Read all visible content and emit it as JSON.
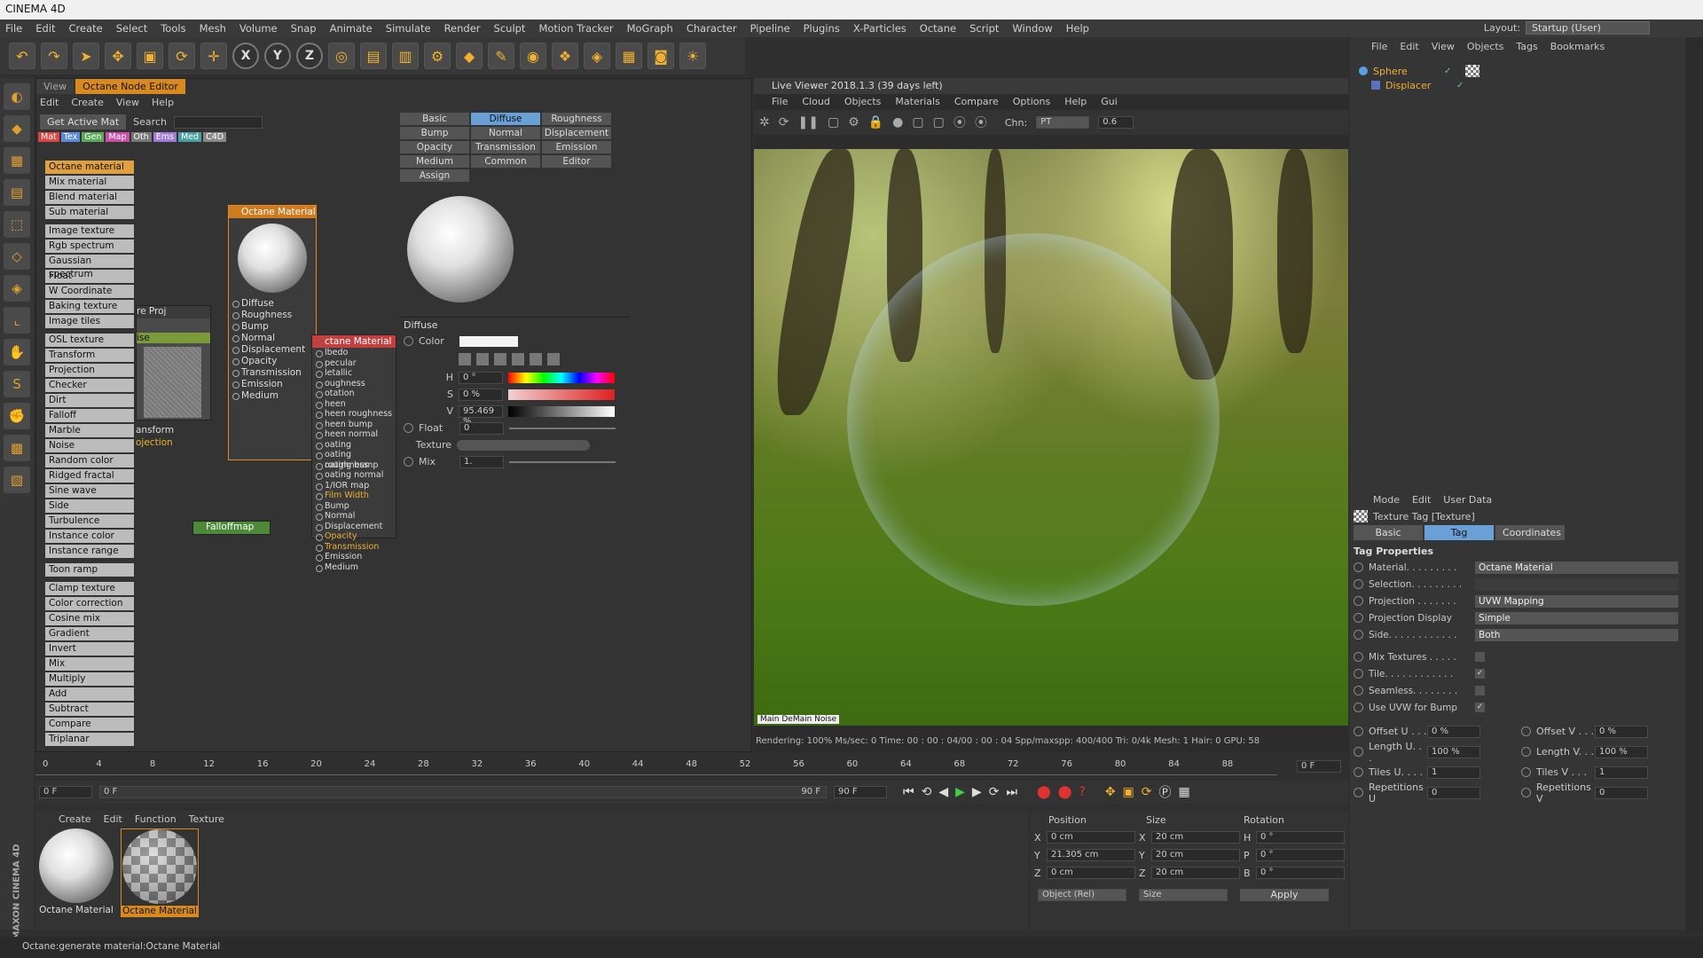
{
  "app": {
    "title": "CINEMA 4D"
  },
  "menubar": {
    "items": [
      "File",
      "Edit",
      "Create",
      "Select",
      "Tools",
      "Mesh",
      "Volume",
      "Snap",
      "Animate",
      "Simulate",
      "Render",
      "Sculpt",
      "Motion Tracker",
      "MoGraph",
      "Character",
      "Pipeline",
      "Plugins",
      "X-Particles",
      "Octane",
      "Script",
      "Window",
      "Help"
    ],
    "layout_label": "Layout:",
    "layout_value": "Startup (User)"
  },
  "node_editor": {
    "tabs": [
      "View",
      "Octane Node Editor"
    ],
    "menu": [
      "Edit",
      "Create",
      "View",
      "Help"
    ],
    "get_active": "Get Active Mat",
    "search": "Search",
    "filters": [
      "Mat",
      "Tex",
      "Gen",
      "Map",
      "Oth",
      "Ems",
      "Med",
      "C4D"
    ],
    "list": [
      "Octane material",
      "Mix material",
      "Blend material",
      "Sub material",
      "Image texture",
      "Rgb spectrum",
      "Gaussian spectrum",
      "Float",
      "W Coordinate",
      "Baking texture",
      "Image tiles",
      "OSL texture",
      "Transform",
      "Projection",
      "Checker",
      "Dirt",
      "Falloff",
      "Marble",
      "Noise",
      "Random color",
      "Ridged fractal",
      "Sine wave",
      "Side",
      "Turbulence",
      "Instance color",
      "Instance range",
      "Toon ramp",
      "Clamp texture",
      "Color correction",
      "Cosine mix",
      "Gradient",
      "Invert",
      "Mix",
      "Multiply",
      "Add",
      "Subtract",
      "Compare",
      "Triplanar"
    ],
    "node1": {
      "title": "Octane Material",
      "ports": [
        "Diffuse",
        "Roughness",
        "Bump",
        "Normal",
        "Displacement",
        "Opacity",
        "Transmission",
        "Emission",
        "Medium"
      ]
    },
    "node2": {
      "title": "ctane Material",
      "ports": [
        "lbedo",
        "pecular",
        "letallic",
        "oughness",
        "otation",
        "heen",
        "heen roughness",
        "heen bump",
        "heen normal",
        "oating",
        "oating roughness",
        "oating bump",
        "oating normal",
        "1/IOR map",
        "Film Width",
        "Bump",
        "Normal",
        "Displacement",
        "Opacity",
        "Transmission",
        "Emission",
        "Medium"
      ]
    },
    "node_proj": "re Proj",
    "node_noise": "ise",
    "node_transform": "ansform",
    "node_projection": "ojection",
    "node_falloff": "Falloffmap"
  },
  "material_panel": {
    "buttons": [
      "Basic",
      "Diffuse",
      "Roughness",
      "Bump",
      "Normal",
      "Displacement",
      "Opacity",
      "Transmission",
      "Emission",
      "Medium",
      "Common",
      "Editor",
      "Assign"
    ],
    "section": "Diffuse",
    "color_label": "Color",
    "h_label": "H",
    "h_val": "0 °",
    "s_label": "S",
    "s_val": "0 %",
    "v_label": "V",
    "v_val": "95.469 %",
    "float_label": "Float",
    "float_val": "0",
    "texture_label": "Texture",
    "mix_label": "Mix",
    "mix_val": "1."
  },
  "viewer": {
    "title": "Live Viewer 2018.1.3 (39 days left)",
    "menu": [
      "File",
      "Cloud",
      "Objects",
      "Materials",
      "Compare",
      "Options",
      "Help",
      "Gui"
    ],
    "chn_label": "Chn:",
    "chn_val": "PT",
    "chn_num": "0.6",
    "noise_label": "Main  DeMain  Noise",
    "stats": "Rendering: 100%  Ms/sec: 0    Time: 00 : 00 : 04/00 : 00 : 04   Spp/maxspp: 400/400    Tri: 0/4k   Mesh: 1   Hair: 0      GPU:      58"
  },
  "object_manager": {
    "menu": [
      "File",
      "Edit",
      "View",
      "Objects",
      "Tags",
      "Bookmarks"
    ],
    "objects": [
      "Sphere",
      "Displacer"
    ]
  },
  "attributes": {
    "menu": [
      "Mode",
      "Edit",
      "User Data"
    ],
    "title": "Texture Tag [Texture]",
    "tabs": [
      "Basic",
      "Tag",
      "Coordinates"
    ],
    "section": "Tag Properties",
    "material_label": "Material. . . . . . . . .",
    "material_val": "Octane Material",
    "selection_label": "Selection. . . . . . . . .",
    "projection_label": "Projection . . . . . . .",
    "projection_val": "UVW Mapping",
    "projdisplay_label": "Projection Display",
    "projdisplay_val": "Simple",
    "side_label": "Side. . . . . . . . . . . .",
    "side_val": "Both",
    "mix_label": "Mix Textures . . . . .",
    "tile_label": "Tile. . . . . . . . . . . .",
    "seamless_label": "Seamless. . . . . . . .",
    "uvw_label": "Use UVW for Bump",
    "offu_label": "Offset U . . .",
    "offu_val": "0 %",
    "offv_label": "Offset V . . .",
    "offv_val": "0 %",
    "lenu_label": "Length U. . .",
    "lenu_val": "100 %",
    "lenv_label": "Length V. . .",
    "lenv_val": "100 %",
    "tileu_label": "Tiles U. . . .",
    "tileu_val": "1",
    "tilev_label": "Tiles V . . .",
    "tilev_val": "1",
    "repu_label": "Repetitions U",
    "repu_val": "0",
    "repv_label": "Repetitions V",
    "repv_val": "0"
  },
  "timeline": {
    "ticks": [
      "0",
      "4",
      "8",
      "12",
      "16",
      "20",
      "24",
      "28",
      "32",
      "36",
      "40",
      "44",
      "48",
      "52",
      "56",
      "60",
      "64",
      "68",
      "72",
      "76",
      "80",
      "84",
      "88"
    ],
    "frame_end": "0 F",
    "start": "0 F",
    "inner_start": "0 F",
    "inner_end": "90 F",
    "end": "90 F"
  },
  "material_manager": {
    "menu": [
      "Create",
      "Edit",
      "Function",
      "Texture"
    ],
    "materials": [
      "Octane Material",
      "Octane Material"
    ]
  },
  "coordinates": {
    "headers": [
      "Position",
      "Size",
      "Rotation"
    ],
    "rows": [
      {
        "axis": "X",
        "pos": "0 cm",
        "saxis": "X",
        "size": "20 cm",
        "raxis": "H",
        "rot": "0 °"
      },
      {
        "axis": "Y",
        "pos": "21.305 cm",
        "saxis": "Y",
        "size": "20 cm",
        "raxis": "P",
        "rot": "0 °"
      },
      {
        "axis": "Z",
        "pos": "0 cm",
        "saxis": "Z",
        "size": "20 cm",
        "raxis": "B",
        "rot": "0 °"
      }
    ],
    "mode": "Object (Rel)",
    "size_mode": "Size",
    "apply": "Apply"
  },
  "status": {
    "text": "Octane:generate material:Octane Material"
  },
  "brand": {
    "maxon": "MAXON",
    "c4d": "CINEMA 4D"
  },
  "colors": {
    "accent": "#d98a1f",
    "selected": "#6aa0d8"
  }
}
